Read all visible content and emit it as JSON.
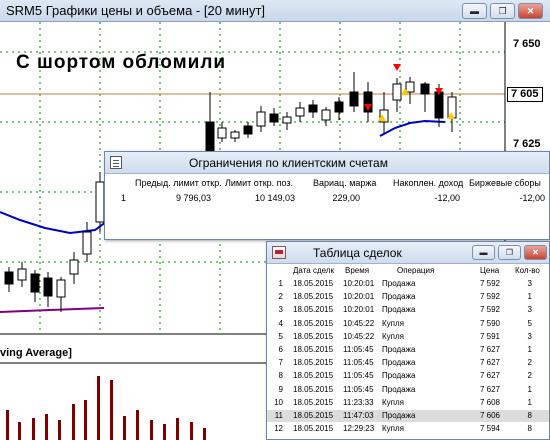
{
  "chart_window": {
    "title": "SRM5 Графики цены и объема - [20 минут]",
    "buttons": {
      "minimize": "▬",
      "restore": "❐",
      "close": "✕"
    },
    "annotation": "С шортом обломили",
    "price_ticks": [
      "7 650",
      "7 625"
    ],
    "last_price": "7 605",
    "indicator_label": "ving Average]",
    "colors": {
      "ma_line": "#0000cc",
      "lower_line": "#800080",
      "support_line": "#c08040",
      "volume_bars": "#800000",
      "grid": "#009000"
    },
    "arrow_colors": {
      "down": "#ff0000",
      "up": "#ffcc00"
    }
  },
  "limits_window": {
    "title": "Ограничения по клиентским счетам",
    "columns": [
      "Предыд. лимит откр.",
      "Лимит откр. поз.",
      "Вариац. маржа",
      "Накоплен. доход",
      "Биржевые сборы"
    ],
    "row": {
      "index": "1",
      "cells": [
        "9 796,03",
        "10 149,03",
        "229,00",
        "-12,00",
        "-12,00"
      ]
    }
  },
  "deals_window": {
    "title": "Таблица сделок",
    "columns": [
      "Дата сделк",
      "Время",
      "Операция",
      "Цена",
      "Кол-во"
    ],
    "rows": [
      {
        "n": "1",
        "date": "18.05.2015",
        "time": "10:20:01",
        "op": "Продажа",
        "price": "7 592",
        "qty": "3"
      },
      {
        "n": "2",
        "date": "18.05.2015",
        "time": "10:20:01",
        "op": "Продажа",
        "price": "7 592",
        "qty": "1"
      },
      {
        "n": "3",
        "date": "18.05.2015",
        "time": "10:20:01",
        "op": "Продажа",
        "price": "7 592",
        "qty": "3"
      },
      {
        "n": "4",
        "date": "18.05.2015",
        "time": "10:45:22",
        "op": "Купля",
        "price": "7 590",
        "qty": "5"
      },
      {
        "n": "5",
        "date": "18.05.2015",
        "time": "10:45:22",
        "op": "Купля",
        "price": "7 591",
        "qty": "3"
      },
      {
        "n": "6",
        "date": "18.05.2015",
        "time": "11:05:45",
        "op": "Продажа",
        "price": "7 627",
        "qty": "1"
      },
      {
        "n": "7",
        "date": "18.05.2015",
        "time": "11:05:45",
        "op": "Продажа",
        "price": "7 627",
        "qty": "2"
      },
      {
        "n": "8",
        "date": "18.05.2015",
        "time": "11:05:45",
        "op": "Продажа",
        "price": "7 627",
        "qty": "2"
      },
      {
        "n": "9",
        "date": "18.05.2015",
        "time": "11:05:45",
        "op": "Продажа",
        "price": "7 627",
        "qty": "1"
      },
      {
        "n": "10",
        "date": "18.05.2015",
        "time": "11:23:33",
        "op": "Купля",
        "price": "7 608",
        "qty": "1"
      },
      {
        "n": "11",
        "date": "18.05.2015",
        "time": "11:47:03",
        "op": "Продажа",
        "price": "7 606",
        "qty": "8",
        "selected": true
      },
      {
        "n": "12",
        "date": "18.05.2015",
        "time": "12:29:23",
        "op": "Купля",
        "price": "7 594",
        "qty": "8"
      }
    ]
  }
}
